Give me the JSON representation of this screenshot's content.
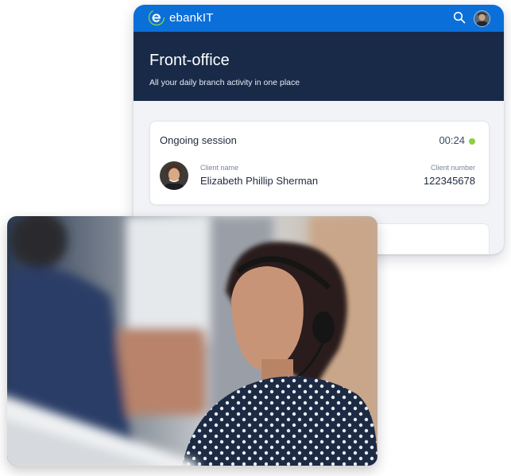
{
  "app": {
    "brand": "ebankIT",
    "icons": {
      "search": "search-icon",
      "avatar": "user-avatar"
    }
  },
  "hero": {
    "title": "Front-office",
    "subtitle": "All your daily branch activity in one place"
  },
  "session": {
    "title": "Ongoing session",
    "timer": "00:24",
    "status_color": "#8cd03f",
    "client_name_label": "Client name",
    "client_name": "Elizabeth Phillip Sherman",
    "client_number_label": "Client number",
    "client_number": "122345678"
  },
  "colors": {
    "topbar": "#0a6fd9",
    "hero": "#182a48"
  },
  "photo": {
    "subject": "call-center-agent-photo"
  }
}
